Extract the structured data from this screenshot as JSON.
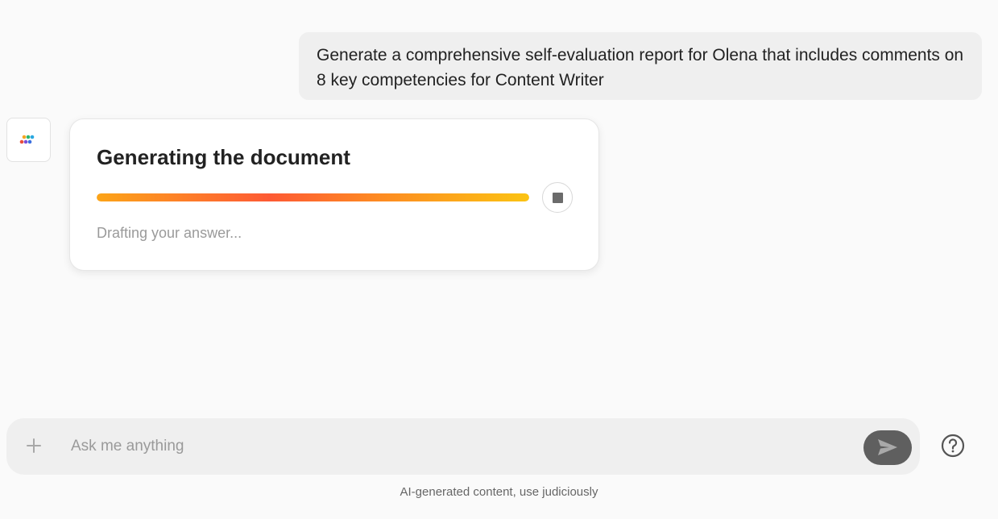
{
  "conversation": {
    "user_message": "Generate a comprehensive self-evaluation report for Olena that includes comments on 8 key competencies for Content Writer"
  },
  "generation_card": {
    "title": "Generating the document",
    "status": "Drafting your answer...",
    "progress": 1.0
  },
  "input": {
    "placeholder": "Ask me anything",
    "value": ""
  },
  "footer": {
    "disclaimer": "AI-generated content, use judiciously"
  },
  "icons": {
    "avatar": "app-logo-icon",
    "stop": "stop-icon",
    "plus": "plus-icon",
    "send": "send-icon",
    "help": "help-icon"
  },
  "colors": {
    "progress_gradient": [
      "#fca418",
      "#fd5a34",
      "#fbc313"
    ],
    "send_button": "#5f5f5f"
  }
}
